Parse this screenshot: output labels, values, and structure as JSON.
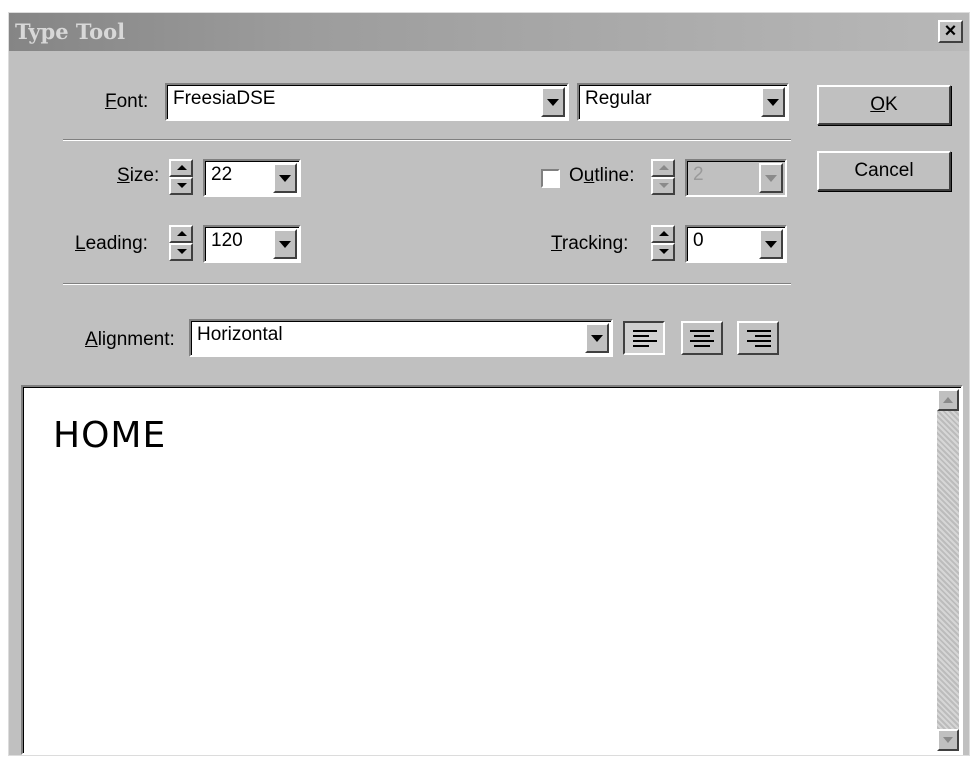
{
  "window": {
    "title": "Type Tool",
    "close_glyph": "×"
  },
  "font": {
    "label_key": "F",
    "label_rest": "ont:",
    "family": "FreesiaDSE",
    "style": "Regular"
  },
  "size": {
    "label_key": "S",
    "label_rest": "ize:",
    "value": "22"
  },
  "leading": {
    "label_key": "L",
    "label_rest": "eading:",
    "value": "120"
  },
  "outline": {
    "label_pre": "O",
    "label_key": "u",
    "label_rest": "tline:",
    "value": "2",
    "checked": false,
    "enabled": false
  },
  "tracking": {
    "label_key": "T",
    "label_rest": "racking:",
    "value": "0"
  },
  "alignment": {
    "label_key": "A",
    "label_rest": "lignment:",
    "value": "Horizontal",
    "buttons": [
      "align-left-icon",
      "align-center-icon",
      "align-right-icon"
    ],
    "active": "align-left-icon"
  },
  "buttons": {
    "ok_key": "O",
    "ok_rest": "K",
    "cancel": "Cancel"
  },
  "editor": {
    "text": "HOME"
  },
  "colors": {
    "dialog_bg": "#c0c0c0",
    "field_bg": "#ffffff",
    "title_bar": "#9c9c9c"
  }
}
